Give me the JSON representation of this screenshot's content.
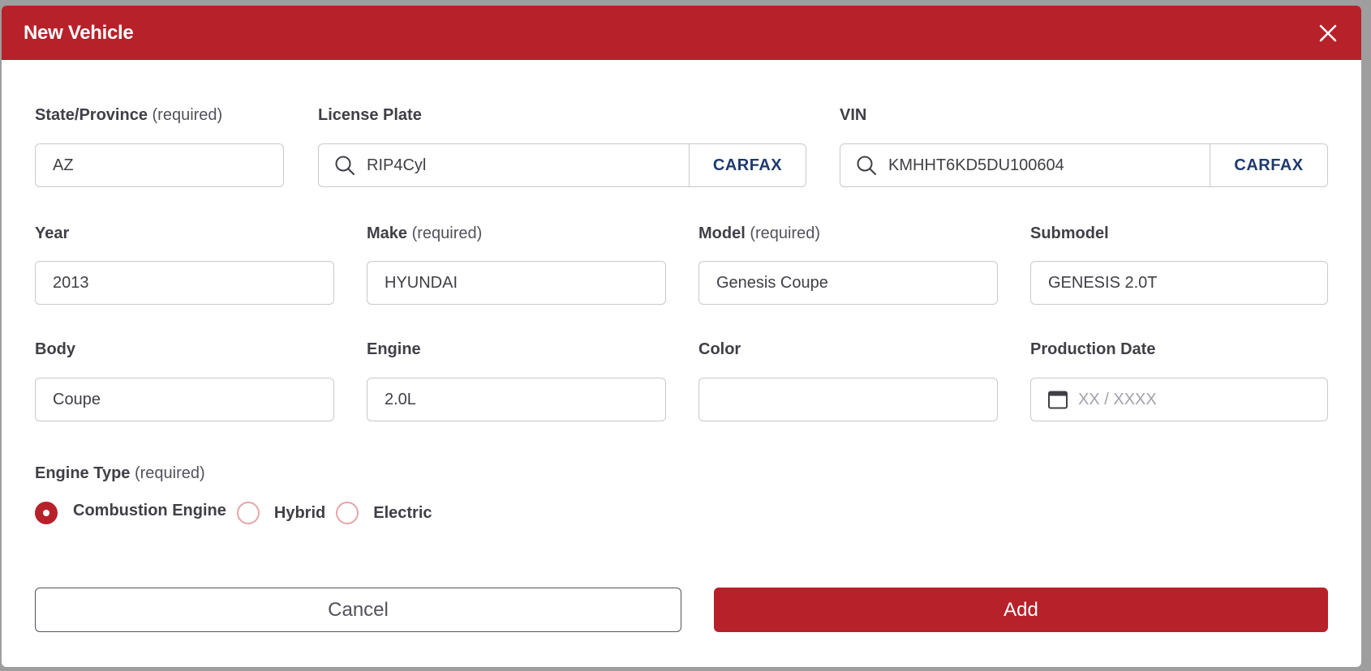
{
  "dialog": {
    "title": "New Vehicle"
  },
  "fields": {
    "state": {
      "label": "State/Province",
      "suffix": "(required)",
      "value": "AZ"
    },
    "plate": {
      "label": "License Plate",
      "value": "RIP4Cyl",
      "button": "CARFAX"
    },
    "vin": {
      "label": "VIN",
      "value": "KMHHT6KD5DU100604",
      "button": "CARFAX"
    },
    "year": {
      "label": "Year",
      "value": "2013"
    },
    "make": {
      "label": "Make",
      "suffix": "(required)",
      "value": "HYUNDAI"
    },
    "model": {
      "label": "Model",
      "suffix": "(required)",
      "value": "Genesis Coupe"
    },
    "submodel": {
      "label": "Submodel",
      "value": "GENESIS 2.0T"
    },
    "body": {
      "label": "Body",
      "value": "Coupe"
    },
    "engine": {
      "label": "Engine",
      "value": "2.0L"
    },
    "color": {
      "label": "Color",
      "value": ""
    },
    "production_date": {
      "label": "Production Date",
      "placeholder": "XX / XXXX"
    }
  },
  "engine_type": {
    "label": "Engine Type",
    "suffix": "(required)",
    "options": [
      {
        "label": "Combustion Engine",
        "checked": true
      },
      {
        "label": "Hybrid",
        "checked": false
      },
      {
        "label": "Electric",
        "checked": false
      }
    ]
  },
  "actions": {
    "cancel": "Cancel",
    "add": "Add"
  },
  "colors": {
    "accent": "#b7212a",
    "carfax_text": "#1e3a6e"
  }
}
